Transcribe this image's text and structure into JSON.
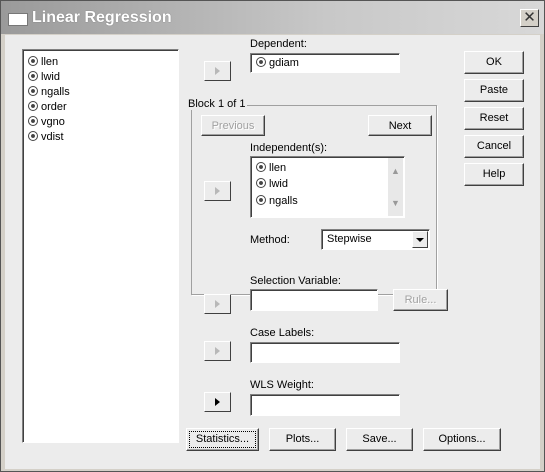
{
  "window": {
    "title": "Linear Regression",
    "close_glyph": "✕"
  },
  "source_variables": [
    "llen",
    "lwid",
    "ngalls",
    "order",
    "vgno",
    "vdist"
  ],
  "dependent": {
    "label": "Dependent:",
    "value": "gdiam"
  },
  "block": {
    "title": "Block 1 of 1",
    "previous": "Previous",
    "next": "Next"
  },
  "independents": {
    "label": "Independent(s):",
    "items": [
      "llen",
      "lwid",
      "ngalls"
    ]
  },
  "method": {
    "label": "Method:",
    "value": "Stepwise"
  },
  "selection_variable": {
    "label": "Selection Variable:",
    "rule_button": "Rule..."
  },
  "case_labels": {
    "label": "Case Labels:"
  },
  "wls_weight": {
    "label": "WLS Weight:"
  },
  "side_buttons": {
    "ok": "OK",
    "paste": "Paste",
    "reset": "Reset",
    "cancel": "Cancel",
    "help": "Help"
  },
  "bottom_buttons": {
    "statistics": "Statistics...",
    "plots": "Plots...",
    "save": "Save...",
    "options": "Options..."
  },
  "icons": {
    "variable": "scale-variable-icon",
    "transfer": "transfer-arrow-icon"
  }
}
